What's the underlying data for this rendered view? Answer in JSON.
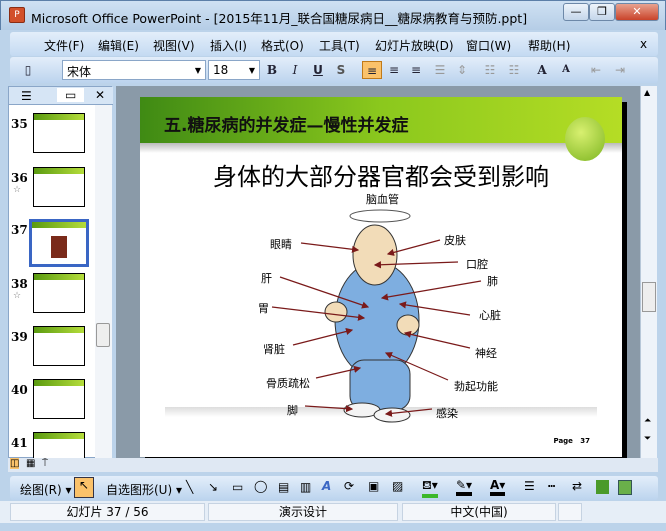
{
  "window": {
    "title": "Microsoft Office PowerPoint - [2015年11月_联合国糖尿病日__糖尿病教育与预防.ppt]",
    "minimize": "—",
    "restore": "❐",
    "close": "✕"
  },
  "menu": [
    "文件(F)",
    "编辑(E)",
    "视图(V)",
    "插入(I)",
    "格式(O)",
    "工具(T)",
    "幻灯片放映(D)",
    "窗口(W)",
    "帮助(H)"
  ],
  "menu_close": "x",
  "toolbar": {
    "font": "宋体",
    "size": "18",
    "bold": "B",
    "italic": "I",
    "underline": "U",
    "shadow": "S",
    "font_grow": "A",
    "font_shrink": "A"
  },
  "thumbs": [
    {
      "num": "35"
    },
    {
      "num": "36"
    },
    {
      "num": "37"
    },
    {
      "num": "38"
    },
    {
      "num": "39"
    },
    {
      "num": "40"
    },
    {
      "num": "41"
    }
  ],
  "slide": {
    "title": "五.糖尿病的并发症—慢性并发症",
    "heading": "身体的大部分器官都会受到影响",
    "page_label": "Page",
    "page_num": "37",
    "labels": [
      "脑血管",
      "眼睛",
      "皮肤",
      "口腔",
      "肺",
      "肝",
      "胃",
      "心脏",
      "肾脏",
      "神经",
      "骨质疏松",
      "勃起功能",
      "脚",
      "感染"
    ]
  },
  "drawbar": {
    "draw": "绘图(R)",
    "autoshapes": "自选图形(U)"
  },
  "status": {
    "slide": "幻灯片 37 / 56",
    "design": "演示设计",
    "lang": "中文(中国)"
  },
  "colors": {
    "band": "#8bc81d",
    "arrow": "#7a1a1a",
    "select": "#3a66c4"
  }
}
